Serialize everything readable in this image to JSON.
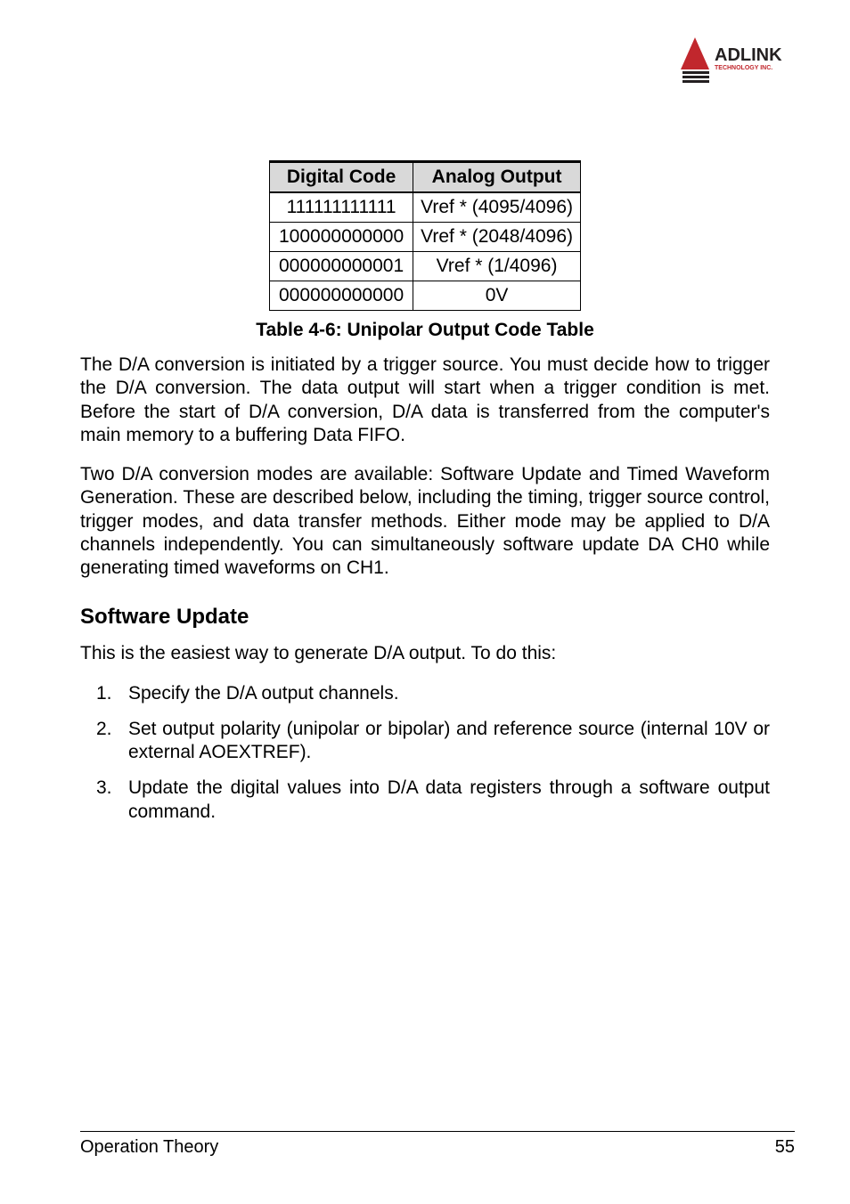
{
  "logo": {
    "brand_top": "ADLINK",
    "brand_bottom": "TECHNOLOGY INC."
  },
  "table": {
    "headers": [
      "Digital Code",
      "Analog Output"
    ],
    "rows": [
      [
        "111111111111",
        "Vref * (4095/4096)"
      ],
      [
        "100000000000",
        "Vref * (2048/4096)"
      ],
      [
        "000000000001",
        "Vref * (1/4096)"
      ],
      [
        "000000000000",
        "0V"
      ]
    ],
    "caption": "Table  4-6: Unipolar Output Code Table"
  },
  "paragraphs": {
    "p1": "The D/A conversion is initiated by a trigger source. You must decide how to trigger the D/A conversion. The data output will start when a trigger condition is met. Before the start of D/A conversion, D/A data is transferred from the computer's main memory to a buffering Data FIFO.",
    "p2": "Two D/A conversion modes are available: Software Update and Timed Waveform Generation. These are described below, including the timing, trigger source control, trigger modes, and data transfer methods. Either mode may be applied to D/A channels independently. You can simultaneously software update DA CH0 while generating timed waveforms on CH1."
  },
  "section": {
    "heading": "Software Update",
    "intro": "This is the easiest way to generate D/A output. To do this:",
    "steps": [
      "Specify the D/A output channels.",
      "Set output polarity (unipolar or bipolar) and reference source (internal 10V or external AOEXTREF).",
      "Update the digital values into D/A data registers through a software output command."
    ]
  },
  "footer": {
    "left": "Operation Theory",
    "right": "55"
  }
}
